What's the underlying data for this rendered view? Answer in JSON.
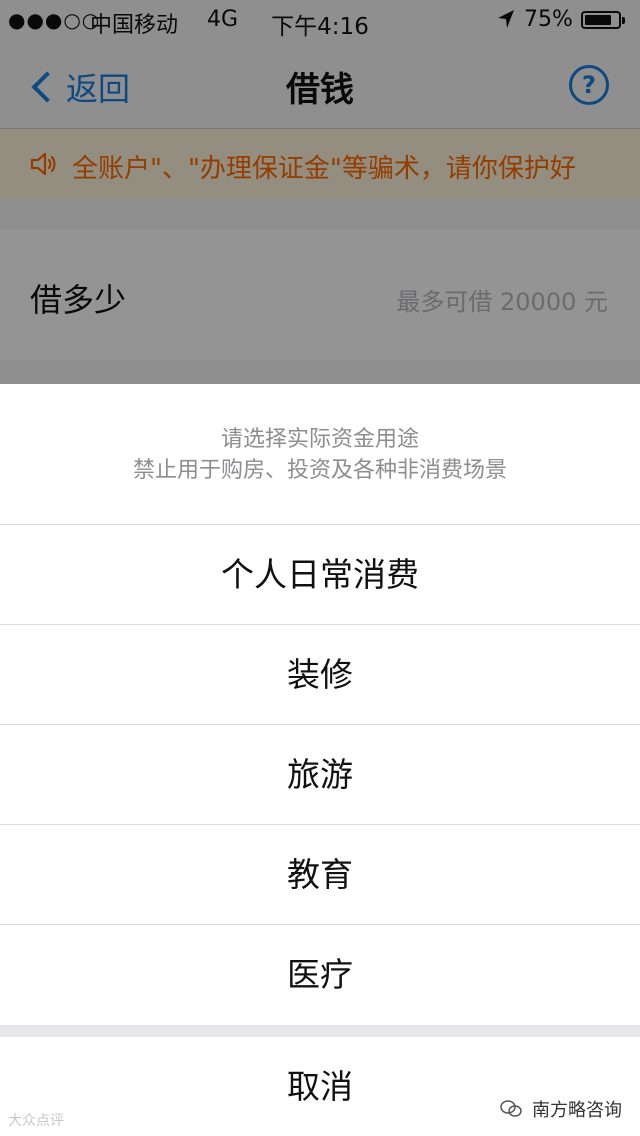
{
  "status_bar": {
    "signal": "●●●○○",
    "carrier": "中国移动",
    "network": "4G",
    "time": "下午4:16",
    "battery_percent": "75%"
  },
  "nav": {
    "back_label": "返回",
    "title": "借钱",
    "help_label": "?"
  },
  "notice": {
    "text": "全账户\"、\"办理保证金\"等骗术，请你保护好"
  },
  "amount": {
    "label": "借多少",
    "hint": "最多可借 20000 元"
  },
  "sheet": {
    "header_line1": "请选择实际资金用途",
    "header_line2": "禁止用于购房、投资及各种非消费场景",
    "options": [
      "个人日常消费",
      "装修",
      "旅游",
      "教育",
      "医疗"
    ],
    "cancel_label": "取消"
  },
  "watermarks": {
    "left": "大众点评",
    "right": "南方略咨询"
  },
  "colors": {
    "accent": "#1a7fe0",
    "notice_text": "#ff6a00",
    "notice_bg": "#fdf5dd"
  }
}
